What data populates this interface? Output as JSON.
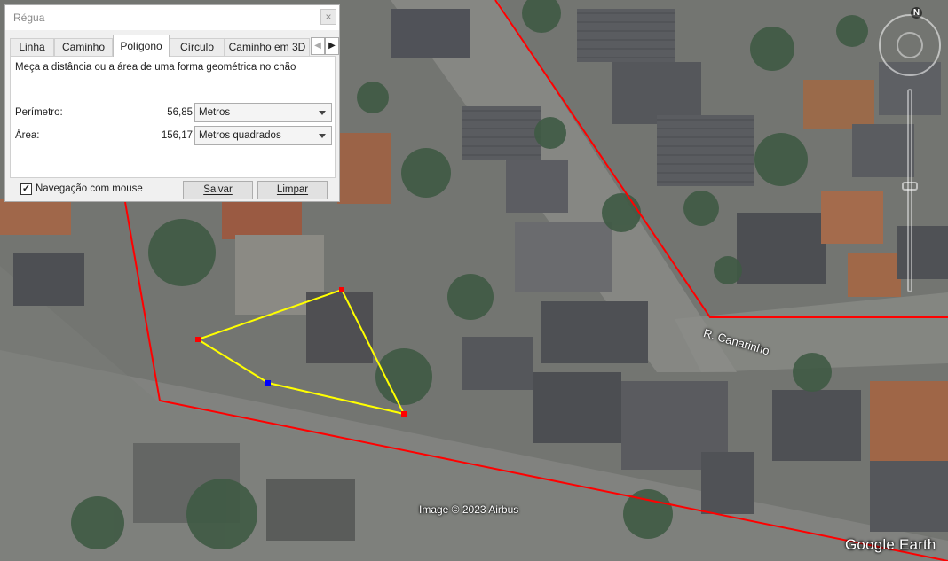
{
  "map": {
    "street_label": "R. Canarinho",
    "copyright": "Image © 2023 Airbus",
    "brand": "Google Earth",
    "compass_label": "N"
  },
  "dialog": {
    "title": "Régua",
    "close_label": "×",
    "tabs": [
      {
        "label": "Linha",
        "active": false
      },
      {
        "label": "Caminho",
        "active": false
      },
      {
        "label": "Polígono",
        "active": true
      },
      {
        "label": "Círculo",
        "active": false
      },
      {
        "label": "Caminho em 3D",
        "active": false
      }
    ],
    "tab_scroll_left": "◀",
    "tab_scroll_right": "▶",
    "instruction": "Meça a distância ou a área de uma forma geométrica no chão",
    "perimeter": {
      "label": "Perímetro:",
      "value": "56,85",
      "unit": "Metros"
    },
    "area": {
      "label": "Área:",
      "value": "156,17",
      "unit": "Metros quadrados"
    },
    "mouse_nav": {
      "label": "Navegação com mouse",
      "checked": true,
      "mark": "✓"
    },
    "save_label": "Salvar",
    "clear_label": "Limpar"
  },
  "colors": {
    "polygon_line": "#ffff00",
    "vertex": "#ff0000",
    "active_vertex": "#0000ff",
    "boundary": "#ff0000"
  }
}
